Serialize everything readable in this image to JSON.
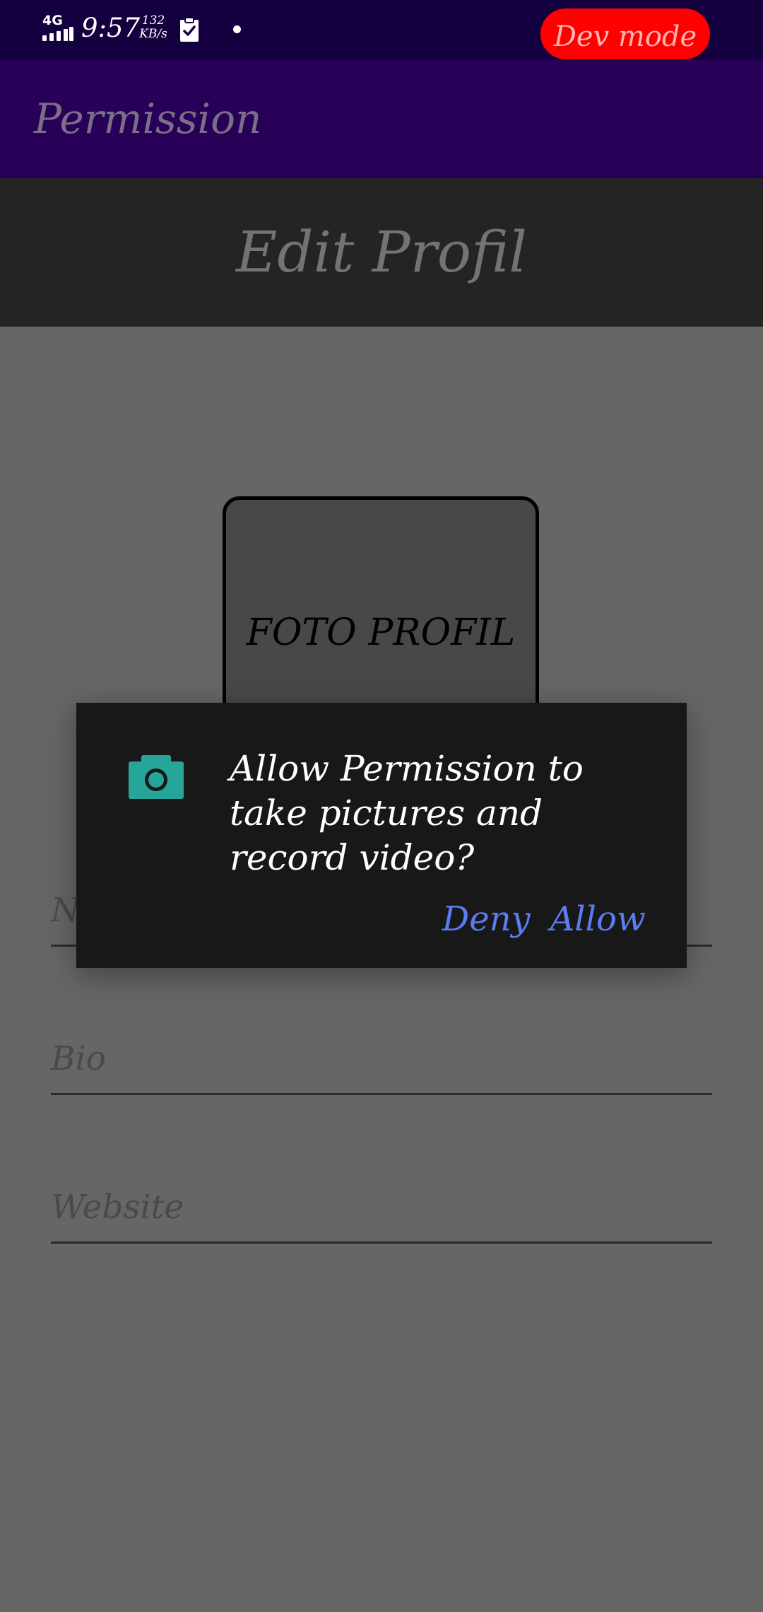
{
  "status_bar": {
    "network_type": "4G",
    "time": "9:57",
    "net_speed_value": "132",
    "net_speed_unit": "KB/s",
    "icons": [
      "signal-icon",
      "clipboard-check-icon",
      "notification-dot-icon"
    ]
  },
  "dev_badge": {
    "label": "Dev mode",
    "color": "#ff0000"
  },
  "app_bar": {
    "title": "Permission",
    "background": "#280058"
  },
  "header": {
    "title": "Edit Profil"
  },
  "profile_photo": {
    "label": "FOTO PROFIL"
  },
  "form": {
    "fields": [
      {
        "placeholder": "Name"
      },
      {
        "placeholder": "Bio"
      },
      {
        "placeholder": "Website"
      }
    ]
  },
  "dialog": {
    "icon": "camera-icon",
    "icon_color": "#26a69a",
    "message": "Allow Permission to take pictures and record video?",
    "deny_label": "Deny",
    "allow_label": "Allow",
    "action_color": "#5b7cf2"
  }
}
